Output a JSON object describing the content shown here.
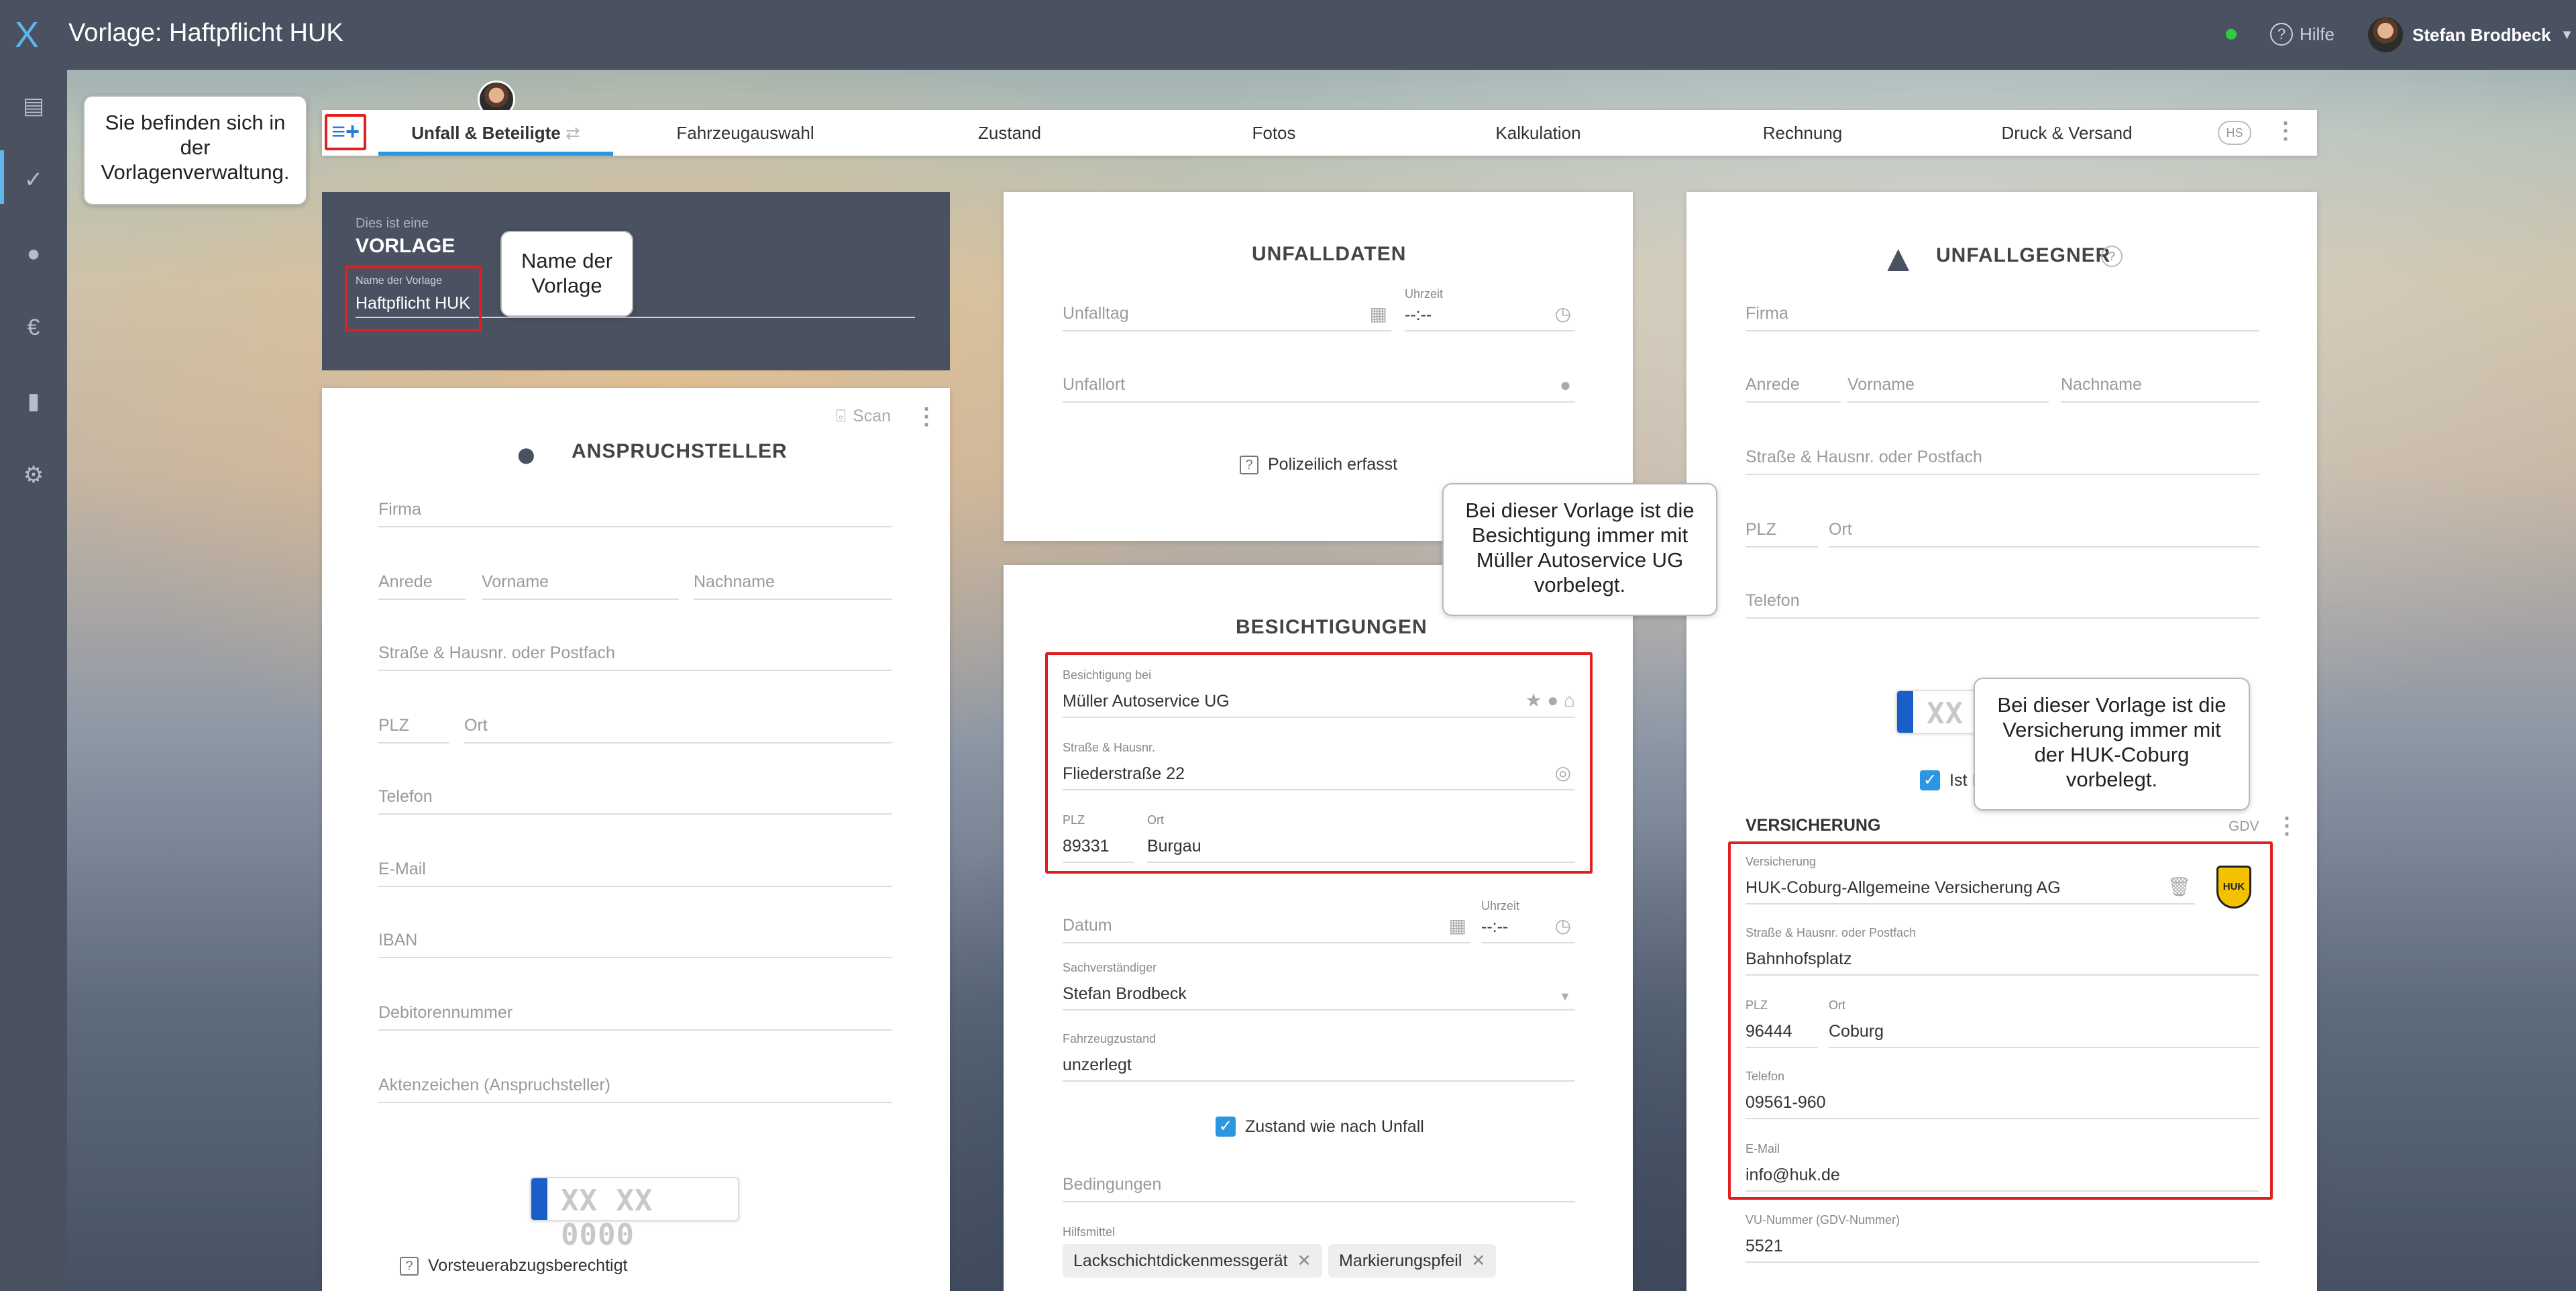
{
  "app": {
    "title": "Vorlage: Haftpflicht HUK",
    "help_label": "Hilfe",
    "user_name": "Stefan Brodbeck",
    "logo_text": "X"
  },
  "sidebar": {
    "icons": [
      "document-icon",
      "check-icon",
      "person-icon",
      "euro-icon",
      "chart-icon",
      "gear-icon"
    ]
  },
  "tabs": [
    {
      "label": "Unfall & Beteiligte"
    },
    {
      "label": "Fahrzeugauswahl"
    },
    {
      "label": "Zustand"
    },
    {
      "label": "Fotos"
    },
    {
      "label": "Kalkulation"
    },
    {
      "label": "Rechnung"
    },
    {
      "label": "Druck & Versand"
    }
  ],
  "tabbar": {
    "hs_badge": "HS"
  },
  "template": {
    "intro": "Dies ist eine",
    "kind": "VORLAGE",
    "name_label": "Name der Vorlage",
    "name_value": "Haftpflicht HUK"
  },
  "claimant": {
    "title": "ANSPRUCHSTELLER",
    "scan_label": "Scan",
    "firma": "Firma",
    "anrede": "Anrede",
    "vorname": "Vorname",
    "nachname": "Nachname",
    "strasse": "Straße & Hausnr. oder Postfach",
    "plz": "PLZ",
    "ort": "Ort",
    "telefon": "Telefon",
    "email": "E-Mail",
    "iban": "IBAN",
    "debitor": "Debitorennummer",
    "aktenzeichen": "Aktenzeichen (Anspruchsteller)",
    "plate": "XX XX 0000",
    "vorsteuer": "Vorsteuerabzugsberechtigt"
  },
  "accident": {
    "title": "UNFALLDATEN",
    "unfalltag": "Unfalltag",
    "uhrzeit_label": "Uhrzeit",
    "uhrzeit_value": "--:--",
    "unfallort": "Unfallort",
    "polizei": "Polizeilich erfasst"
  },
  "inspections": {
    "title": "BESICHTIGUNGEN",
    "bei_label": "Besichtigung bei",
    "bei_value": "Müller Autoservice UG",
    "strasse_label": "Straße & Hausnr.",
    "strasse_value": "Fliederstraße 22",
    "plz_label": "PLZ",
    "plz_value": "89331",
    "ort_label": "Ort",
    "ort_value": "Burgau",
    "datum": "Datum",
    "uhrzeit_label": "Uhrzeit",
    "uhrzeit_value": "--:--",
    "sv_label": "Sachverständiger",
    "sv_value": "Stefan Brodbeck",
    "zustand_label": "Fahrzeugzustand",
    "zustand_value": "unzerlegt",
    "zustand_check": "Zustand wie nach Unfall",
    "bedingungen": "Bedingungen",
    "hilfsmittel_label": "Hilfsmittel",
    "chips": [
      "Lackschichtdickenmessgerät",
      "Markierungspfeil"
    ]
  },
  "opponent": {
    "title": "UNFALLGEGNER",
    "firma": "Firma",
    "anrede": "Anrede",
    "vorname": "Vorname",
    "nachname": "Nachname",
    "strasse": "Straße & Hausnr. oder Postfach",
    "plz": "PLZ",
    "ort": "Ort",
    "telefon": "Telefon",
    "plate": "XX",
    "ist_label": "Ist I"
  },
  "insurance": {
    "title": "VERSICHERUNG",
    "gdv": "GDV",
    "name_label": "Versicherung",
    "name_value": "HUK-Coburg-Allgemeine Versicherung AG",
    "strasse_label": "Straße & Hausnr. oder Postfach",
    "strasse_value": "Bahnhofsplatz",
    "plz_label": "PLZ",
    "plz_value": "96444",
    "ort_label": "Ort",
    "ort_value": "Coburg",
    "tel_label": "Telefon",
    "tel_value": "09561-960",
    "mail_label": "E-Mail",
    "mail_value": "info@huk.de",
    "vu_label": "VU-Nummer (GDV-Nummer)",
    "vu_value": "5521",
    "logo_text": "HUK"
  },
  "callouts": {
    "vorlagen": "Sie befinden sich in der Vorlagenverwaltung.",
    "name": "Name der Vorlage",
    "besichtigung": "Bei dieser Vorlage ist die Besichtigung immer mit Müller Autoservice UG vorbelegt.",
    "versicherung": "Bei dieser Vorlage ist die Versicherung immer mit der HUK-Coburg vorbelegt."
  },
  "colors": {
    "topbar": "#4a5160",
    "accent": "#2b97e0",
    "callout_border": "#e02020"
  }
}
